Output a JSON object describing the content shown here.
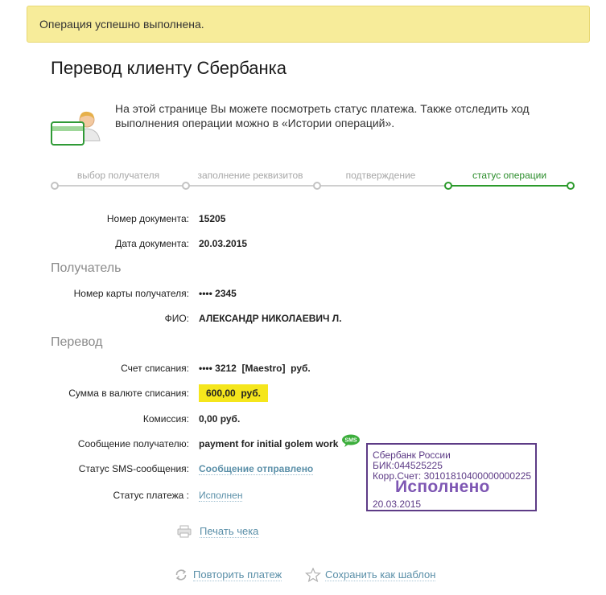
{
  "banner": {
    "text": "Операция успешно выполнена."
  },
  "page": {
    "title": "Перевод клиенту Сбербанка"
  },
  "info": {
    "text": "На этой странице Вы можете посмотреть статус платежа. Также отследить ход выполнения операции можно в «Истории операций»."
  },
  "steps": [
    {
      "label": "выбор получателя",
      "state": "done"
    },
    {
      "label": "заполнение реквизитов",
      "state": "done"
    },
    {
      "label": "подтверждение",
      "state": "done"
    },
    {
      "label": "статус операции",
      "state": "current"
    }
  ],
  "document": {
    "number_label": "Номер документа:",
    "number_value": "15205",
    "date_label": "Дата документа:",
    "date_value": "20.03.2015"
  },
  "recipient": {
    "section_title": "Получатель",
    "card_label": "Номер карты получателя:",
    "card_value": "•••• 2345",
    "name_label": "ФИО:",
    "name_value": "АЛЕКСАНДР НИКОЛАЕВИЧ Л."
  },
  "transfer": {
    "section_title": "Перевод",
    "account_label": "Счет списания:",
    "account_value": "•••• 3212  [Maestro]  руб.",
    "amount_label": "Сумма в валюте списания:",
    "amount_value": "600,00  руб.",
    "fee_label": "Комиссия:",
    "fee_value": "0,00 руб.",
    "message_label": "Сообщение получателю:",
    "message_value": "payment for initial golem work",
    "sms_badge": "SMS",
    "sms_status_label": "Статус SMS-сообщения:",
    "sms_status_value": "Сообщение отправлено",
    "payment_status_label": "Статус платежа :",
    "payment_status_value": "Исполнен"
  },
  "stamp": {
    "bank": "Сбербанк России",
    "bik": "БИК:044525225",
    "corr": "Корр.Счет: 30101810400000000225",
    "status": "Исполнено",
    "date": "20.03.2015"
  },
  "actions": {
    "print": "Печать чека",
    "repeat": "Повторить платеж",
    "save_template": "Сохранить как шаблон"
  },
  "colors": {
    "accent_green": "#2b9a2b",
    "banner_bg": "#f7ec9a",
    "amount_highlight": "#f5e61c",
    "link": "#5a8fa8",
    "stamp": "#5d3b86"
  }
}
